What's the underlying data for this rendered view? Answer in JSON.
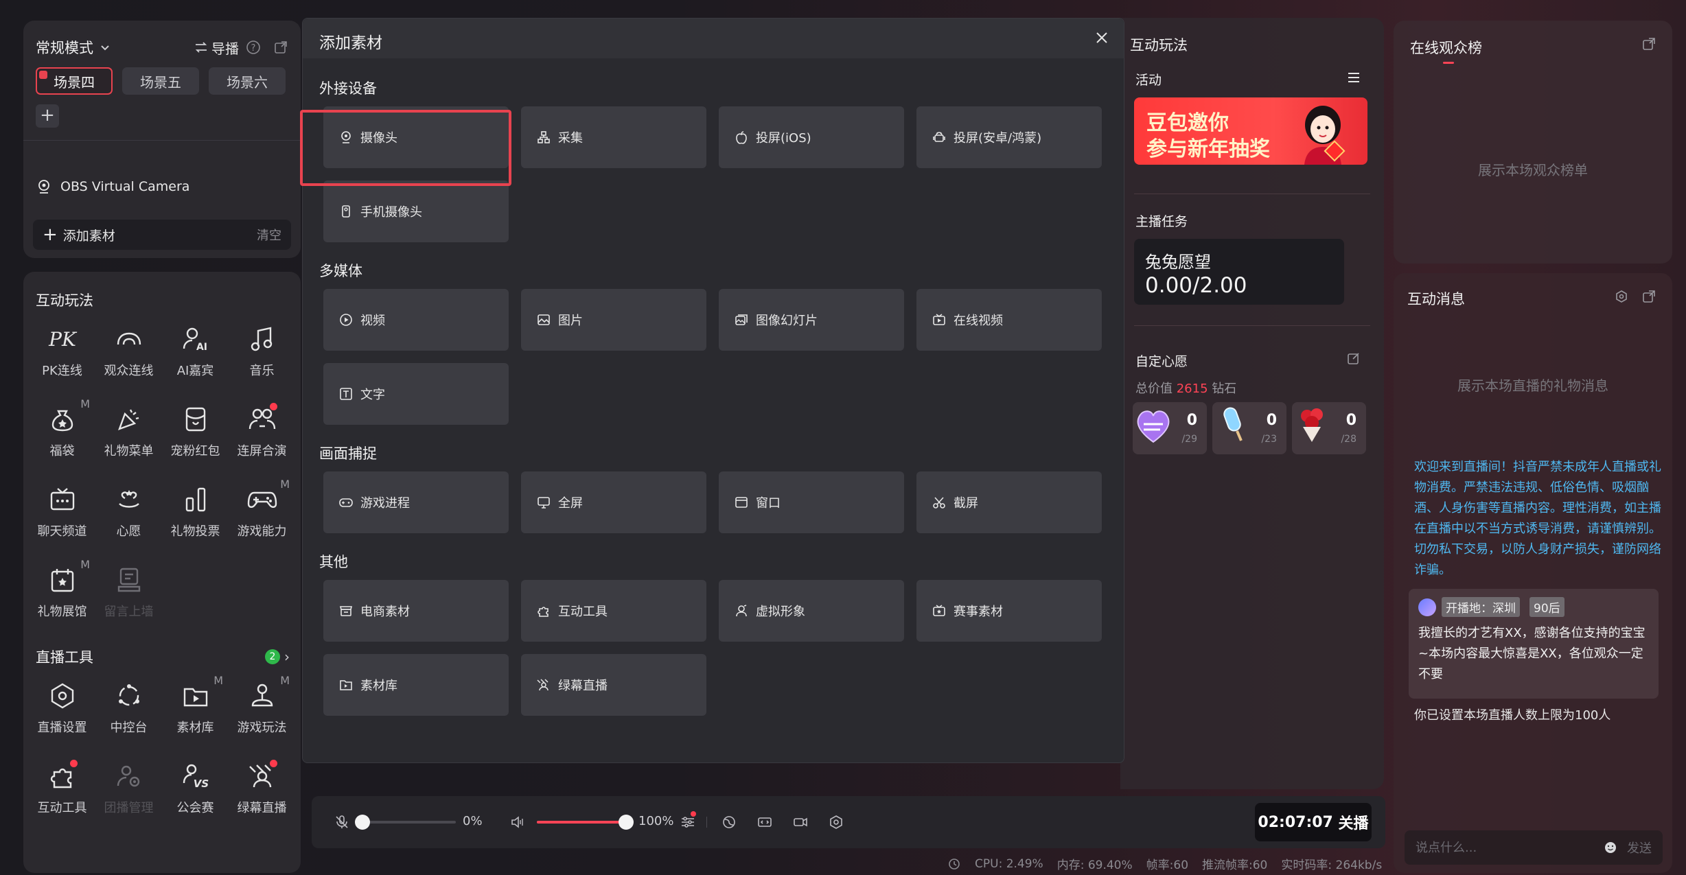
{
  "scene_panel": {
    "mode": "常规模式",
    "guide": "导播",
    "scenes": [
      "场景四",
      "场景五",
      "场景六"
    ],
    "source": "OBS Virtual Camera",
    "add_material": "添加素材",
    "clear": "清空"
  },
  "tools_panel": {
    "interact_title": "互动玩法",
    "interact_tools": [
      {
        "label": "PK连线"
      },
      {
        "label": "观众连线"
      },
      {
        "label": "AI嘉宾"
      },
      {
        "label": "音乐"
      },
      {
        "label": "福袋"
      },
      {
        "label": "礼物菜单"
      },
      {
        "label": "宠粉红包"
      },
      {
        "label": "连屏合演"
      },
      {
        "label": "聊天频道"
      },
      {
        "label": "心愿"
      },
      {
        "label": "礼物投票"
      },
      {
        "label": "游戏能力"
      },
      {
        "label": "礼物展馆"
      },
      {
        "label": "留言上墙"
      }
    ],
    "badge_m": "M",
    "live_tools_title": "直播工具",
    "live_tools_count": "2",
    "live_tools": [
      {
        "label": "直播设置"
      },
      {
        "label": "中控台"
      },
      {
        "label": "素材库"
      },
      {
        "label": "游戏玩法"
      },
      {
        "label": "互动工具"
      },
      {
        "label": "团播管理"
      },
      {
        "label": "公会赛"
      },
      {
        "label": "绿幕直播"
      }
    ]
  },
  "modal": {
    "title": "添加素材",
    "categories": [
      {
        "title": "外接设备",
        "items": [
          "摄像头",
          "采集",
          "投屏(iOS)",
          "投屏(安卓/鸿蒙)",
          "手机摄像头"
        ]
      },
      {
        "title": "多媒体",
        "items": [
          "视频",
          "图片",
          "图像幻灯片",
          "在线视频",
          "文字"
        ]
      },
      {
        "title": "画面捕捉",
        "items": [
          "游戏进程",
          "全屏",
          "窗口",
          "截屏"
        ]
      },
      {
        "title": "其他",
        "items": [
          "电商素材",
          "互动工具",
          "虚拟形象",
          "赛事素材",
          "素材库",
          "绿幕直播"
        ]
      }
    ]
  },
  "interact_panel": {
    "title": "互动玩法",
    "activity": "活动",
    "banner_line1": "豆包邀你",
    "banner_line2": "参与新年抽奖",
    "task_title": "主播任务",
    "task_name": "兔兔愿望",
    "task_value": "0.00/2.00",
    "wish_title": "自定心愿",
    "total_prefix": "总价值",
    "total_value": "2615",
    "total_unit": "钻石",
    "gifts": [
      {
        "count": "0",
        "total": "/29"
      },
      {
        "count": "0",
        "total": "/23"
      },
      {
        "count": "0",
        "total": "/28"
      }
    ]
  },
  "rank_panel": {
    "title": "在线观众榜",
    "placeholder": "展示本场观众榜单"
  },
  "msg_panel": {
    "title": "互动消息",
    "placeholder": "展示本场直播的礼物消息",
    "notice": "欢迎来到直播间！抖音严禁未成年人直播或礼物消费。严禁违法违规、低俗色情、吸烟酗酒、人身伤害等直播内容。理性消费，如主播在直播中以不当方式诱导消费，请谨慎辨别。切勿私下交易，以防人身财产损失，谨防网络诈骗。",
    "tag_location": "开播地：深圳",
    "tag_age": "90后",
    "intro": "我擅长的才艺有XX，感谢各位支持的宝宝~本场内容最大惊喜是XX，各位观众一定不要",
    "limit": "你已设置本场直播人数上限为100人",
    "input_placeholder": "说点什么...",
    "send": "发送"
  },
  "control_bar": {
    "mic_level": "0%",
    "volume_level": "100%",
    "mic_fraction": 0.0,
    "volume_fraction": 1.0,
    "live_time": "02:07:07",
    "live_action": "关播"
  },
  "status": {
    "cpu": "CPU: 2.49%",
    "mem": "内存: 69.40%",
    "fps": "帧率:60",
    "push_fps": "推流帧率:60",
    "bitrate": "实时码率: 264kb/s"
  }
}
